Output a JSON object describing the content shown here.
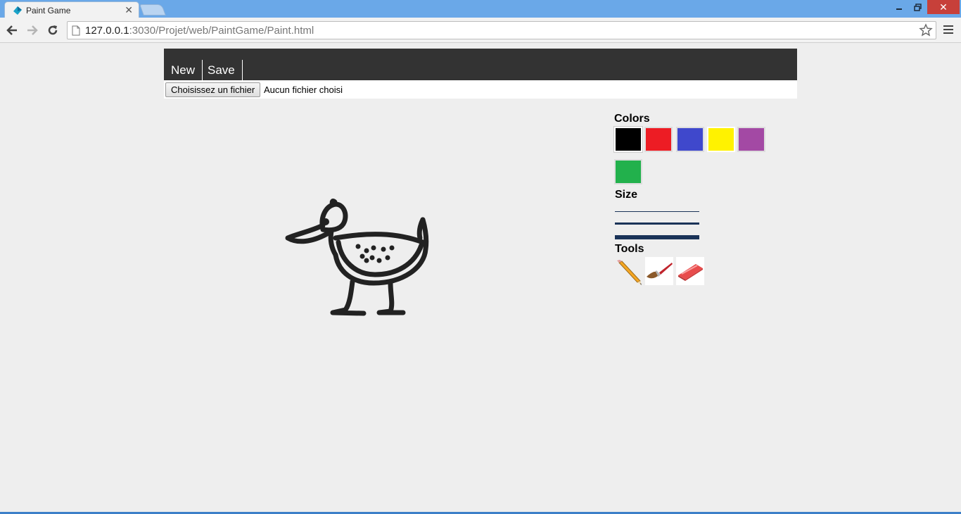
{
  "browser": {
    "tab_title": "Paint Game",
    "url_host": "127.0.0.1",
    "url_rest": ":3030/Projet/web/PaintGame/Paint.html"
  },
  "nav": {
    "new_label": "New",
    "save_label": "Save"
  },
  "file_input": {
    "button_label": "Choisissez un fichier",
    "status_text": "Aucun fichier choisi"
  },
  "palette": {
    "colors_title": "Colors",
    "size_title": "Size",
    "tools_title": "Tools",
    "colors": [
      {
        "name": "black",
        "hex": "#000000"
      },
      {
        "name": "red",
        "hex": "#ed1c24"
      },
      {
        "name": "blue",
        "hex": "#3f48cc"
      },
      {
        "name": "yellow",
        "hex": "#fff200"
      },
      {
        "name": "purple",
        "hex": "#a349a4"
      },
      {
        "name": "green",
        "hex": "#22b14c"
      }
    ],
    "tools": [
      "pencil-icon",
      "brush-icon",
      "eraser-icon"
    ]
  },
  "canvas": {
    "drawing": "duck-drawing",
    "stroke_color": "#222222"
  }
}
